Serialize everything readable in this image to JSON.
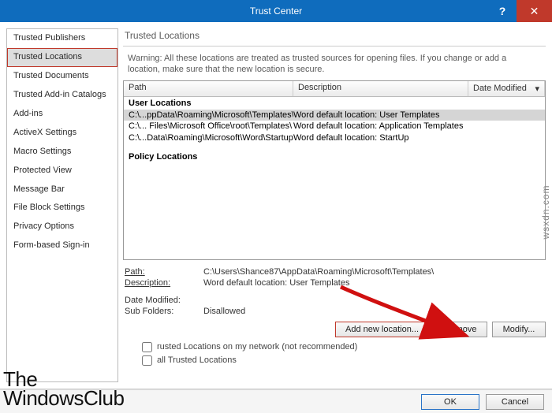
{
  "window": {
    "title": "Trust Center"
  },
  "sidebar": {
    "items": [
      {
        "label": "Trusted Publishers"
      },
      {
        "label": "Trusted Locations",
        "selected": true
      },
      {
        "label": "Trusted Documents"
      },
      {
        "label": "Trusted Add-in Catalogs"
      },
      {
        "label": "Add-ins"
      },
      {
        "label": "ActiveX Settings"
      },
      {
        "label": "Macro Settings"
      },
      {
        "label": "Protected View"
      },
      {
        "label": "Message Bar"
      },
      {
        "label": "File Block Settings"
      },
      {
        "label": "Privacy Options"
      },
      {
        "label": "Form-based Sign-in"
      }
    ]
  },
  "pane": {
    "title": "Trusted Locations",
    "warning": "Warning: All these locations are treated as trusted sources for opening files. If you change or add a location, make sure that the new location is secure.",
    "columns": {
      "path": "Path",
      "description": "Description",
      "date": "Date Modified"
    },
    "groups": {
      "user": "User Locations",
      "policy": "Policy Locations"
    },
    "rows": [
      {
        "path": "C:\\...ppData\\Roaming\\Microsoft\\Templates\\",
        "desc": "Word default location: User Templates",
        "selected": true
      },
      {
        "path": "C:\\... Files\\Microsoft Office\\root\\Templates\\",
        "desc": "Word default location: Application Templates"
      },
      {
        "path": "C:\\...Data\\Roaming\\Microsoft\\Word\\Startup\\",
        "desc": "Word default location: StartUp"
      }
    ]
  },
  "details": {
    "path_label": "Path:",
    "path_val": "C:\\Users\\Shance87\\AppData\\Roaming\\Microsoft\\Templates\\",
    "desc_label": "Description:",
    "desc_val": "Word default location: User Templates",
    "date_label": "Date Modified:",
    "date_val": "",
    "sub_label": "Sub Folders:",
    "sub_val": "Disallowed"
  },
  "buttons": {
    "add": "Add new location...",
    "remove": "Remove",
    "modify": "Modify..."
  },
  "checks": {
    "network": "rusted Locations on my network (not recommended)",
    "disable": "all Trusted Locations"
  },
  "footer": {
    "ok": "OK",
    "cancel": "Cancel"
  },
  "watermark": {
    "left1": "The",
    "left2": "WindowsClub",
    "right": "wsxdn.com"
  }
}
